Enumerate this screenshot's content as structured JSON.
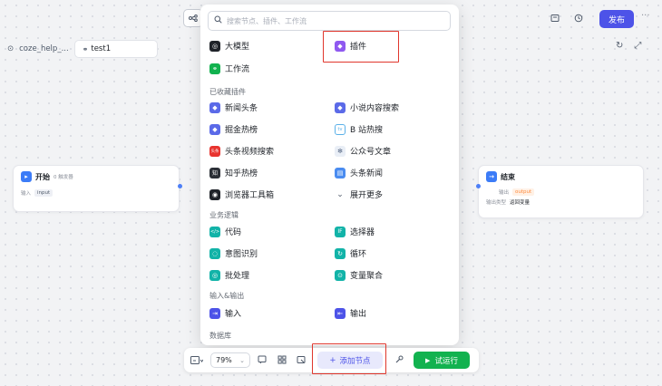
{
  "toolbar": {
    "publish_label": "发布",
    "more_icon": "more-icon",
    "workflow_icon": "workflow-icon"
  },
  "breadcrumb": {
    "project": "coze_help_...",
    "workflow": "test1"
  },
  "popup": {
    "search_placeholder": "搜索节点、插件、工作流",
    "top_items": [
      {
        "label": "大模型",
        "icon": "llm-icon"
      },
      {
        "label": "插件",
        "icon": "plugin-icon"
      },
      {
        "label": "工作流",
        "icon": "workflow-icon"
      }
    ],
    "fav_section": "已收藏插件",
    "fav_items": [
      {
        "label": "新闻头条",
        "icon": "plugin-icon"
      },
      {
        "label": "小说内容搜索",
        "icon": "plugin-icon"
      },
      {
        "label": "掘金热榜",
        "icon": "plugin-icon"
      },
      {
        "label": "B 站热搜",
        "icon": "bilibili-icon"
      },
      {
        "label": "头条视频搜索",
        "icon": "toutiao-icon",
        "icon_text": "头条"
      },
      {
        "label": "公众号文章",
        "icon": "wechat-icon"
      },
      {
        "label": "知乎热榜",
        "icon": "zhihu-icon"
      },
      {
        "label": "头条新闻",
        "icon": "news-icon"
      },
      {
        "label": "浏览器工具箱",
        "icon": "browser-icon"
      },
      {
        "label": "展开更多",
        "icon": "chevron-down-icon"
      }
    ],
    "logic_section": "业务逻辑",
    "logic_items": [
      {
        "label": "代码",
        "icon": "code-icon",
        "icon_text": "</>"
      },
      {
        "label": "选择器",
        "icon": "condition-icon",
        "icon_text": "IF"
      },
      {
        "label": "意图识别",
        "icon": "intent-icon"
      },
      {
        "label": "循环",
        "icon": "loop-icon"
      },
      {
        "label": "批处理",
        "icon": "batch-icon"
      },
      {
        "label": "变量聚合",
        "icon": "aggregate-icon"
      }
    ],
    "io_section": "输入&输出",
    "io_items": [
      {
        "label": "输入",
        "icon": "input-icon"
      },
      {
        "label": "输出",
        "icon": "output-icon"
      }
    ],
    "db_section": "数据库"
  },
  "start_node": {
    "title": "开始",
    "badge": "0 触发器",
    "input_label": "输入",
    "input_tag": "input"
  },
  "end_node": {
    "title": "结束",
    "output_label": "输出",
    "output_tag": "output",
    "type_label": "输出类型",
    "type_value": "返回变量"
  },
  "bottom_bar": {
    "zoom": "79%",
    "add_node_label": "添加节点",
    "run_label": "试运行"
  },
  "colors": {
    "accent": "#4d53e8",
    "run": "#12b24f",
    "highlight": "#e0362c"
  }
}
